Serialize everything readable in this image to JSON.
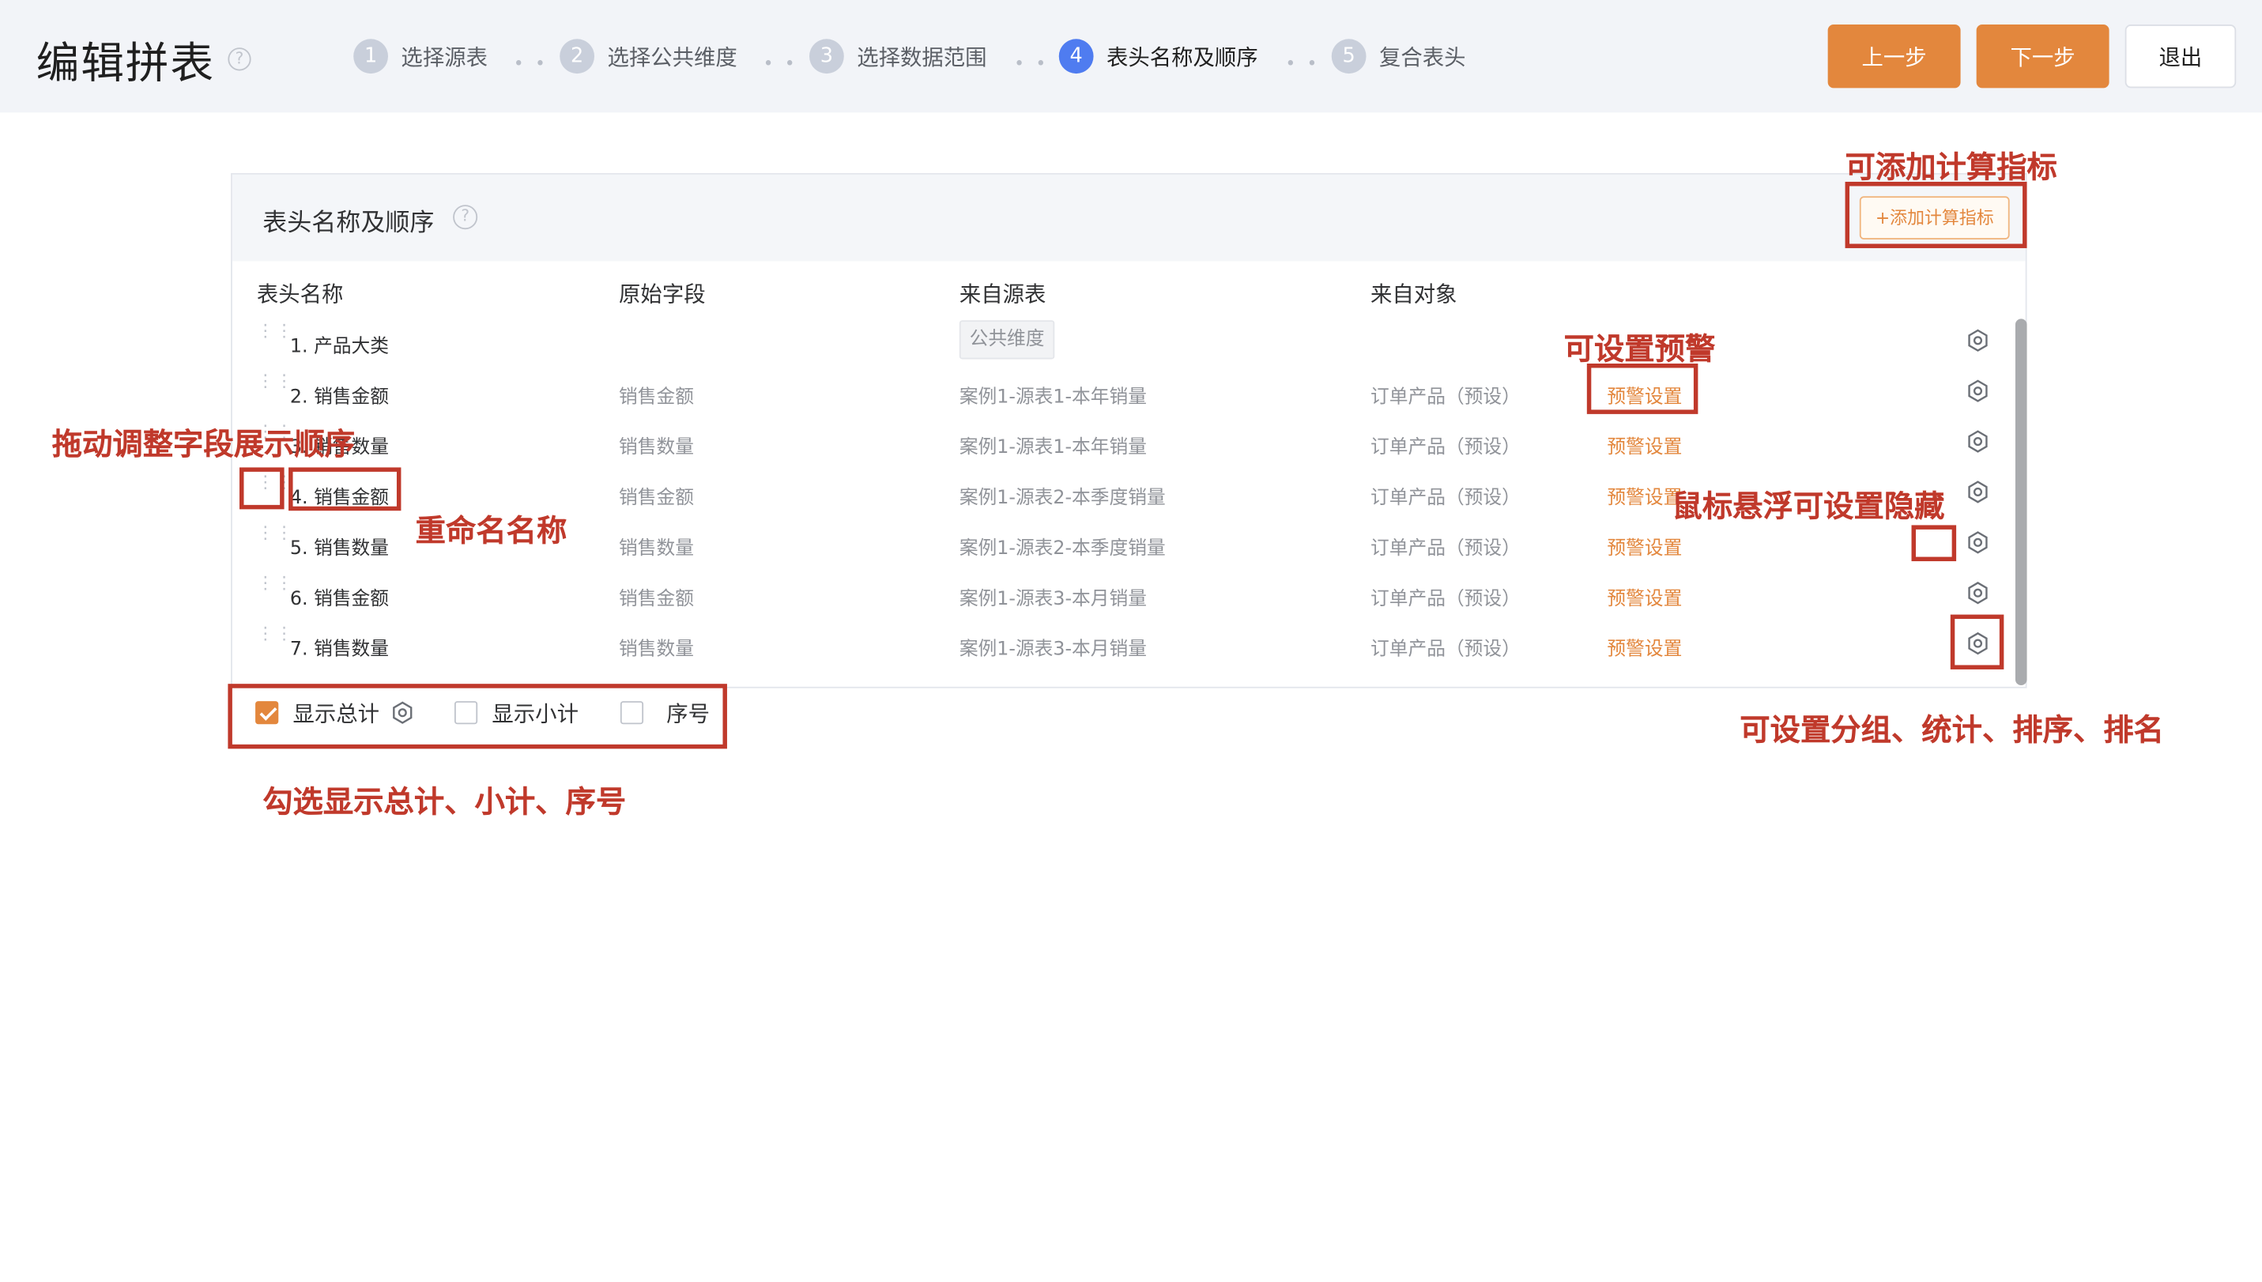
{
  "header": {
    "title": "编辑拼表",
    "steps": [
      {
        "num": "1",
        "label": "选择源表"
      },
      {
        "num": "2",
        "label": "选择公共维度"
      },
      {
        "num": "3",
        "label": "选择数据范围"
      },
      {
        "num": "4",
        "label": "表头名称及顺序"
      },
      {
        "num": "5",
        "label": "复合表头"
      }
    ],
    "step_separator": "• •",
    "active_step": 4,
    "prev_label": "上一步",
    "next_label": "下一步",
    "exit_label": "退出"
  },
  "help_glyph": "?",
  "card": {
    "title": "表头名称及顺序",
    "add_metric_label": "+添加计算指标",
    "columns": [
      "表头名称",
      "原始字段",
      "来自源表",
      "来自对象"
    ],
    "rows": [
      {
        "name": "1. 产品大类",
        "field": "",
        "source": "",
        "tag": "公共维度",
        "object": "",
        "warning": ""
      },
      {
        "name": "2. 销售金额",
        "field": "销售金额",
        "source": "案例1-源表1-本年销量",
        "tag": "",
        "object": "订单产品（预设）",
        "warning": "预警设置"
      },
      {
        "name": "3. 销售数量",
        "field": "销售数量",
        "source": "案例1-源表1-本年销量",
        "tag": "",
        "object": "订单产品（预设）",
        "warning": "预警设置"
      },
      {
        "name": "4. 销售金额",
        "field": "销售金额",
        "source": "案例1-源表2-本季度销量",
        "tag": "",
        "object": "订单产品（预设）",
        "warning": "预警设置"
      },
      {
        "name": "5. 销售数量",
        "field": "销售数量",
        "source": "案例1-源表2-本季度销量",
        "tag": "",
        "object": "订单产品（预设）",
        "warning": "预警设置"
      },
      {
        "name": "6. 销售金额",
        "field": "销售金额",
        "source": "案例1-源表3-本月销量",
        "tag": "",
        "object": "订单产品（预设）",
        "warning": "预警设置"
      },
      {
        "name": "7. 销售数量",
        "field": "销售数量",
        "source": "案例1-源表3-本月销量",
        "tag": "",
        "object": "订单产品（预设）",
        "warning": "预警设置"
      }
    ]
  },
  "options": {
    "show_total": {
      "label": "显示总计",
      "checked": true
    },
    "show_subtotal": {
      "label": "显示小计",
      "checked": false
    },
    "serial": {
      "label": "序号",
      "checked": false
    }
  },
  "annotations": {
    "add_metric": "可添加计算指标",
    "warning": "可设置预警",
    "drag": "拖动调整字段展示顺序",
    "rename": "重命名名称",
    "hover_hide": "鼠标悬浮可设置隐藏",
    "settings": "可设置分组、统计、排序、排名",
    "options": "勾选显示总计、小计、序号"
  },
  "colors": {
    "accent": "#e3873d",
    "active_step": "#4f7cf0",
    "annotation": "#c0392b"
  }
}
